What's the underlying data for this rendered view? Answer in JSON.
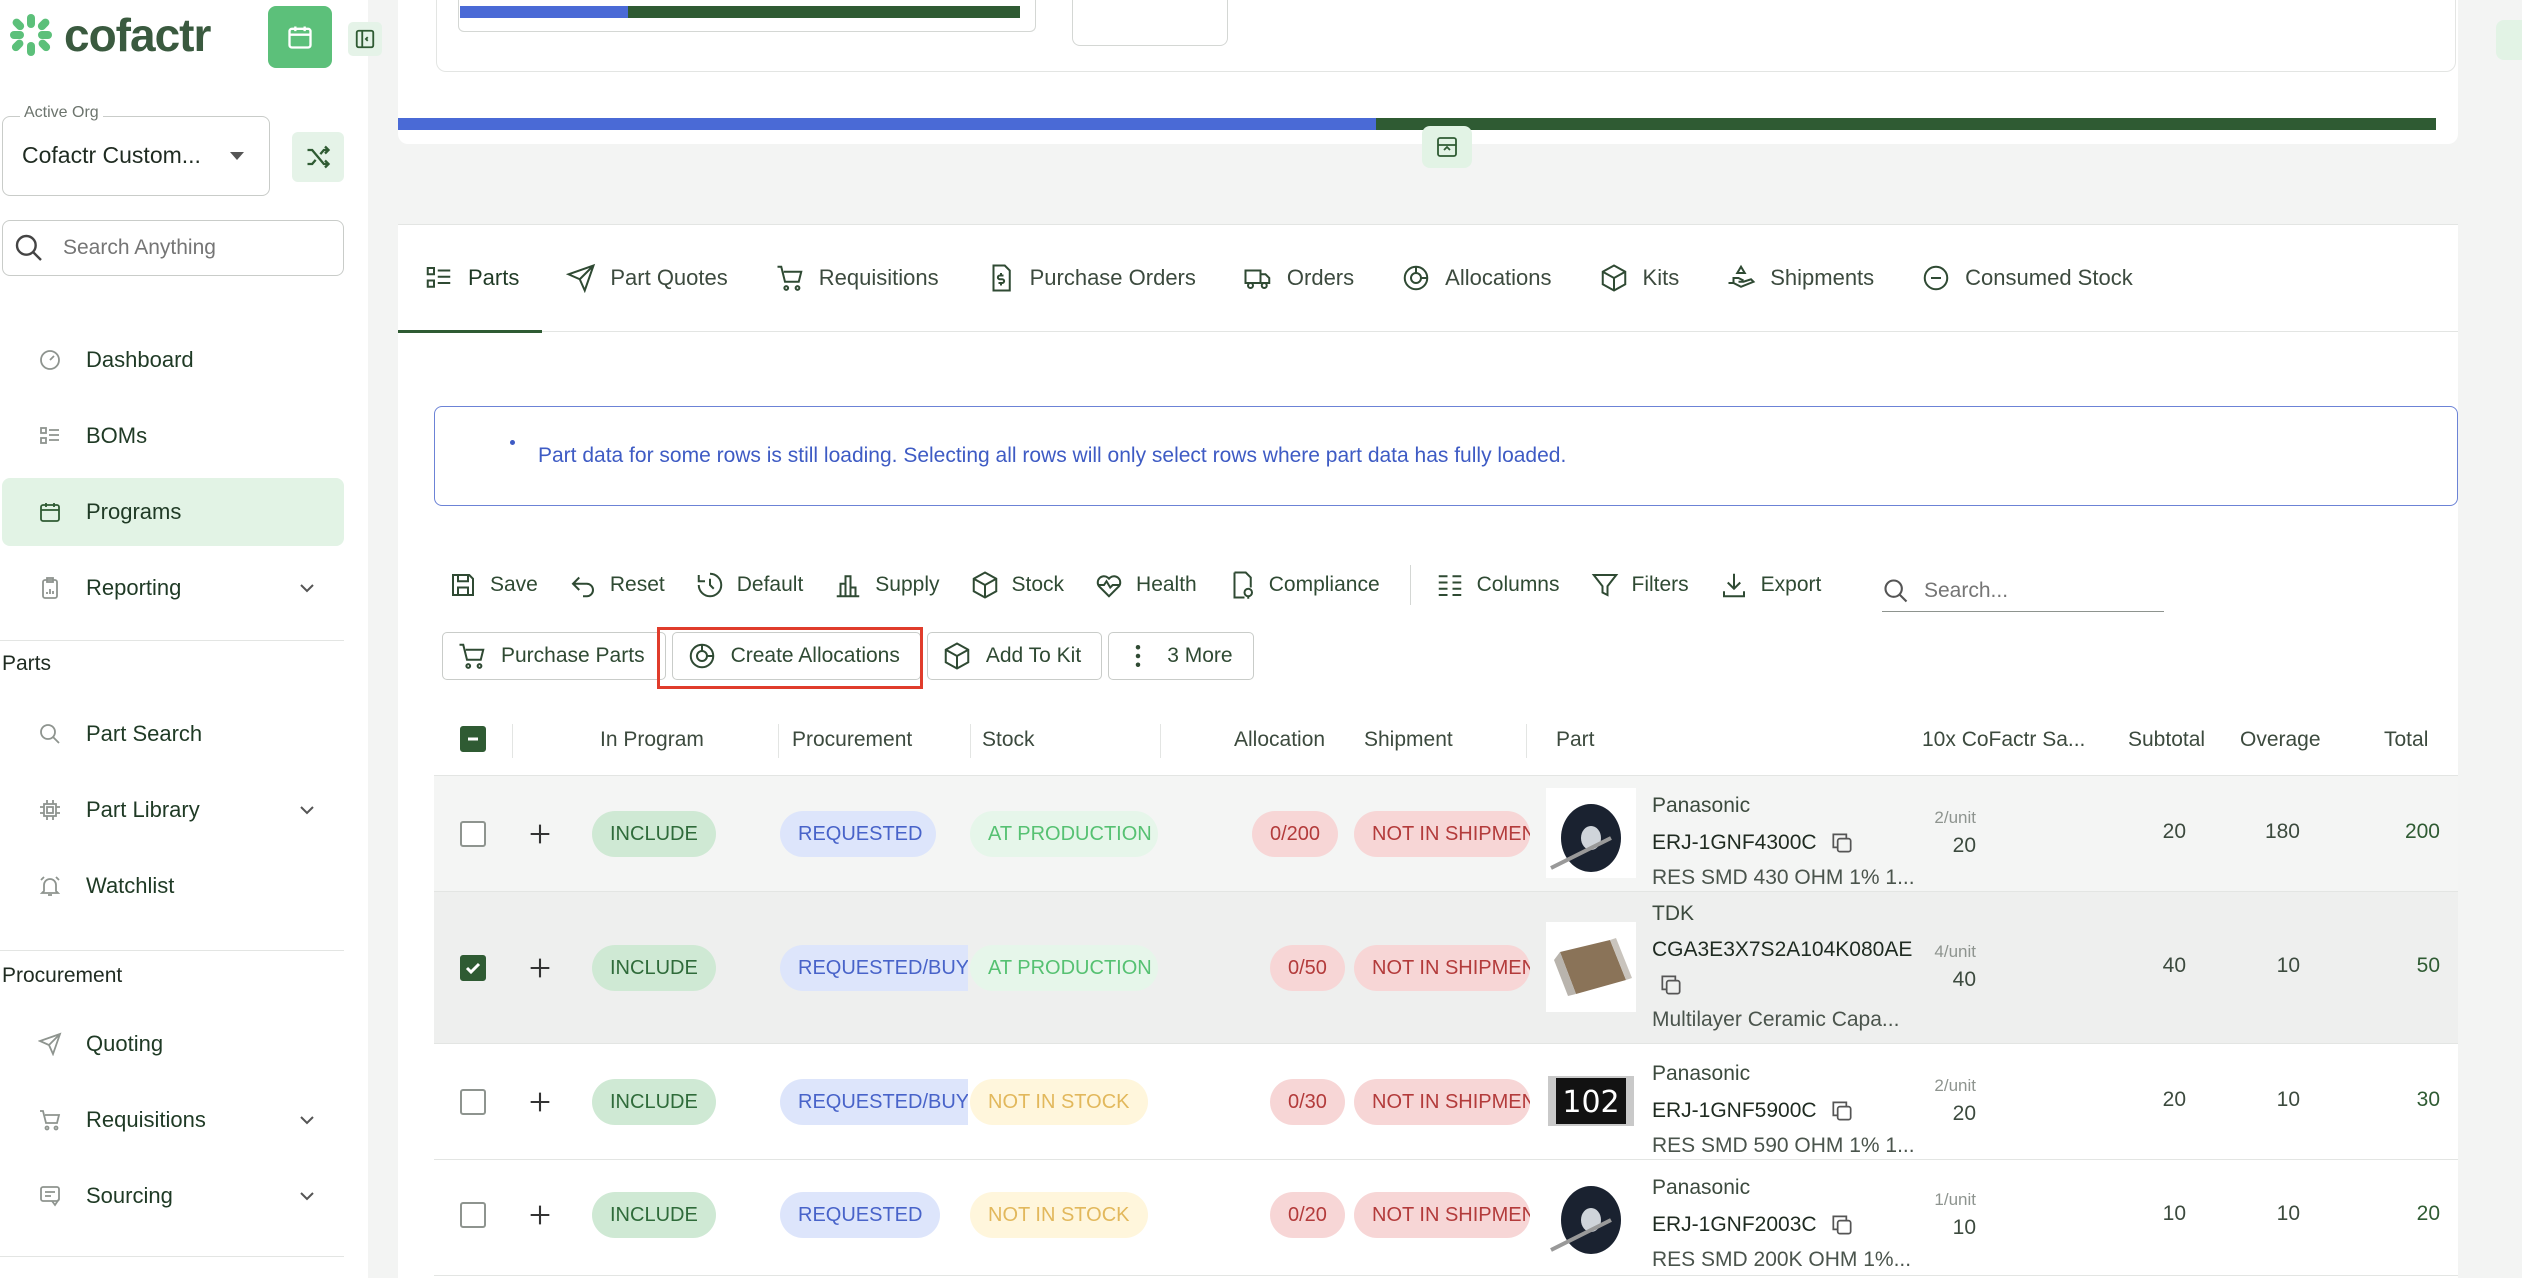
{
  "brand": {
    "name": "cofactr",
    "accent": "#5cc07a",
    "dark_green": "#2f5b33",
    "blue": "#4a6ad6"
  },
  "org": {
    "label": "Active Org",
    "value": "Cofactr Custom..."
  },
  "search": {
    "placeholder": "Search Anything"
  },
  "nav": {
    "main": [
      {
        "label": "Dashboard",
        "icon": "dashboard-icon"
      },
      {
        "label": "BOMs",
        "icon": "list-icon"
      },
      {
        "label": "Programs",
        "icon": "calendar-icon",
        "active": true
      },
      {
        "label": "Reporting",
        "icon": "clipboard-icon",
        "expandable": true
      }
    ],
    "parts_section": "Parts",
    "parts": [
      {
        "label": "Part Search",
        "icon": "search-icon"
      },
      {
        "label": "Part Library",
        "icon": "chip-icon",
        "expandable": true
      },
      {
        "label": "Watchlist",
        "icon": "bell-icon"
      }
    ],
    "procurement_section": "Procurement",
    "procurement": [
      {
        "label": "Quoting",
        "icon": "send-icon"
      },
      {
        "label": "Requisitions",
        "icon": "cart-icon",
        "expandable": true
      },
      {
        "label": "Sourcing",
        "icon": "sourcing-icon",
        "expandable": true
      }
    ]
  },
  "progress": {
    "mini_blue_fraction": 0.3,
    "big_blue_fraction": 0.48
  },
  "tabs": [
    {
      "label": "Parts",
      "icon": "parts-icon",
      "active": true
    },
    {
      "label": "Part Quotes",
      "icon": "send-icon"
    },
    {
      "label": "Requisitions",
      "icon": "cart-icon"
    },
    {
      "label": "Purchase Orders",
      "icon": "document-dollar-icon"
    },
    {
      "label": "Orders",
      "icon": "truck-icon"
    },
    {
      "label": "Allocations",
      "icon": "pie-icon"
    },
    {
      "label": "Kits",
      "icon": "box-icon"
    },
    {
      "label": "Shipments",
      "icon": "hand-icon"
    },
    {
      "label": "Consumed Stock",
      "icon": "minus-circle-icon"
    }
  ],
  "banner": {
    "text": "Part data for some rows is still loading. Selecting all rows will only select rows where part data has fully loaded."
  },
  "toolbar": {
    "save": "Save",
    "reset": "Reset",
    "default": "Default",
    "supply": "Supply",
    "stock": "Stock",
    "health": "Health",
    "compliance": "Compliance",
    "columns": "Columns",
    "filters": "Filters",
    "export": "Export",
    "search_placeholder": "Search..."
  },
  "actions": {
    "purchase_parts": "Purchase Parts",
    "create_allocations": "Create Allocations",
    "add_to_kit": "Add To Kit",
    "more": "3 More"
  },
  "table": {
    "headers": {
      "in_program": "In Program",
      "procurement": "Procurement",
      "stock": "Stock",
      "allocation": "Allocation",
      "shipment": "Shipment",
      "part": "Part",
      "sample": "10x CoFactr Sa...",
      "subtotal": "Subtotal",
      "overage": "Overage",
      "total": "Total"
    },
    "rows": [
      {
        "checked": false,
        "in_program": "INCLUDE",
        "procurement": "REQUESTED",
        "stock": "AT PRODUCTION (",
        "stock_kind": "prod",
        "allocation": "0/200",
        "shipment": "NOT IN SHIPMENT",
        "manufacturer": "Panasonic",
        "mpn": "ERJ-1GNF4300C",
        "description": "RES SMD 430 OHM 1% 1...",
        "image": "reel",
        "per_unit": "2/unit",
        "qty": "20",
        "subtotal": "20",
        "overage": "180",
        "total": "200"
      },
      {
        "checked": true,
        "in_program": "INCLUDE",
        "procurement": "REQUESTED/BUY/",
        "stock": "AT PRODUCTION (",
        "stock_kind": "prod",
        "allocation": "0/50",
        "shipment": "NOT IN SHIPMENT",
        "manufacturer": "TDK",
        "mpn": "CGA3E3X7S2A104K080AE",
        "description": "Multilayer Ceramic Capa...",
        "image": "capacitor",
        "per_unit": "4/unit",
        "qty": "40",
        "subtotal": "40",
        "overage": "10",
        "total": "50"
      },
      {
        "checked": false,
        "in_program": "INCLUDE",
        "procurement": "REQUESTED/BUY/",
        "stock": "NOT IN STOCK",
        "stock_kind": "nostock",
        "allocation": "0/30",
        "shipment": "NOT IN SHIPMENT",
        "manufacturer": "Panasonic",
        "mpn": "ERJ-1GNF5900C",
        "description": "RES SMD 590 OHM 1% 1...",
        "image": "resistor",
        "image_text": "102",
        "per_unit": "2/unit",
        "qty": "20",
        "subtotal": "20",
        "overage": "10",
        "total": "30"
      },
      {
        "checked": false,
        "in_program": "INCLUDE",
        "procurement": "REQUESTED",
        "stock": "NOT IN STOCK",
        "stock_kind": "nostock",
        "allocation": "0/20",
        "shipment": "NOT IN SHIPMENT",
        "manufacturer": "Panasonic",
        "mpn": "ERJ-1GNF2003C",
        "description": "RES SMD 200K OHM 1%...",
        "image": "reel",
        "per_unit": "1/unit",
        "qty": "10",
        "subtotal": "10",
        "overage": "10",
        "total": "20"
      }
    ]
  }
}
